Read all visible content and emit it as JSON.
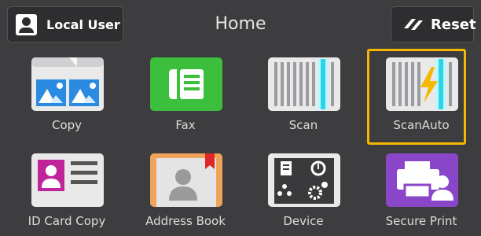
{
  "header": {
    "user_label": "Local User",
    "title": "Home",
    "reset_label": "Reset"
  },
  "tiles": [
    {
      "label": "Copy",
      "icon": "copy-icon"
    },
    {
      "label": "Fax",
      "icon": "fax-icon"
    },
    {
      "label": "Scan",
      "icon": "scan-icon"
    },
    {
      "label": "ScanAuto",
      "icon": "scan-auto-icon",
      "selected": true
    },
    {
      "label": "ID Card Copy",
      "icon": "id-card-icon"
    },
    {
      "label": "Address Book",
      "icon": "address-book-icon"
    },
    {
      "label": "Device",
      "icon": "device-icon"
    },
    {
      "label": "Secure Print",
      "icon": "secure-print-icon"
    }
  ],
  "colors": {
    "background": "#3d3d3f",
    "selection": "#f5b800",
    "fax_green": "#3cbf3c",
    "scan_cyan": "#29d6e8",
    "id_magenta": "#c0249a",
    "secure_purple": "#8a46c9"
  }
}
